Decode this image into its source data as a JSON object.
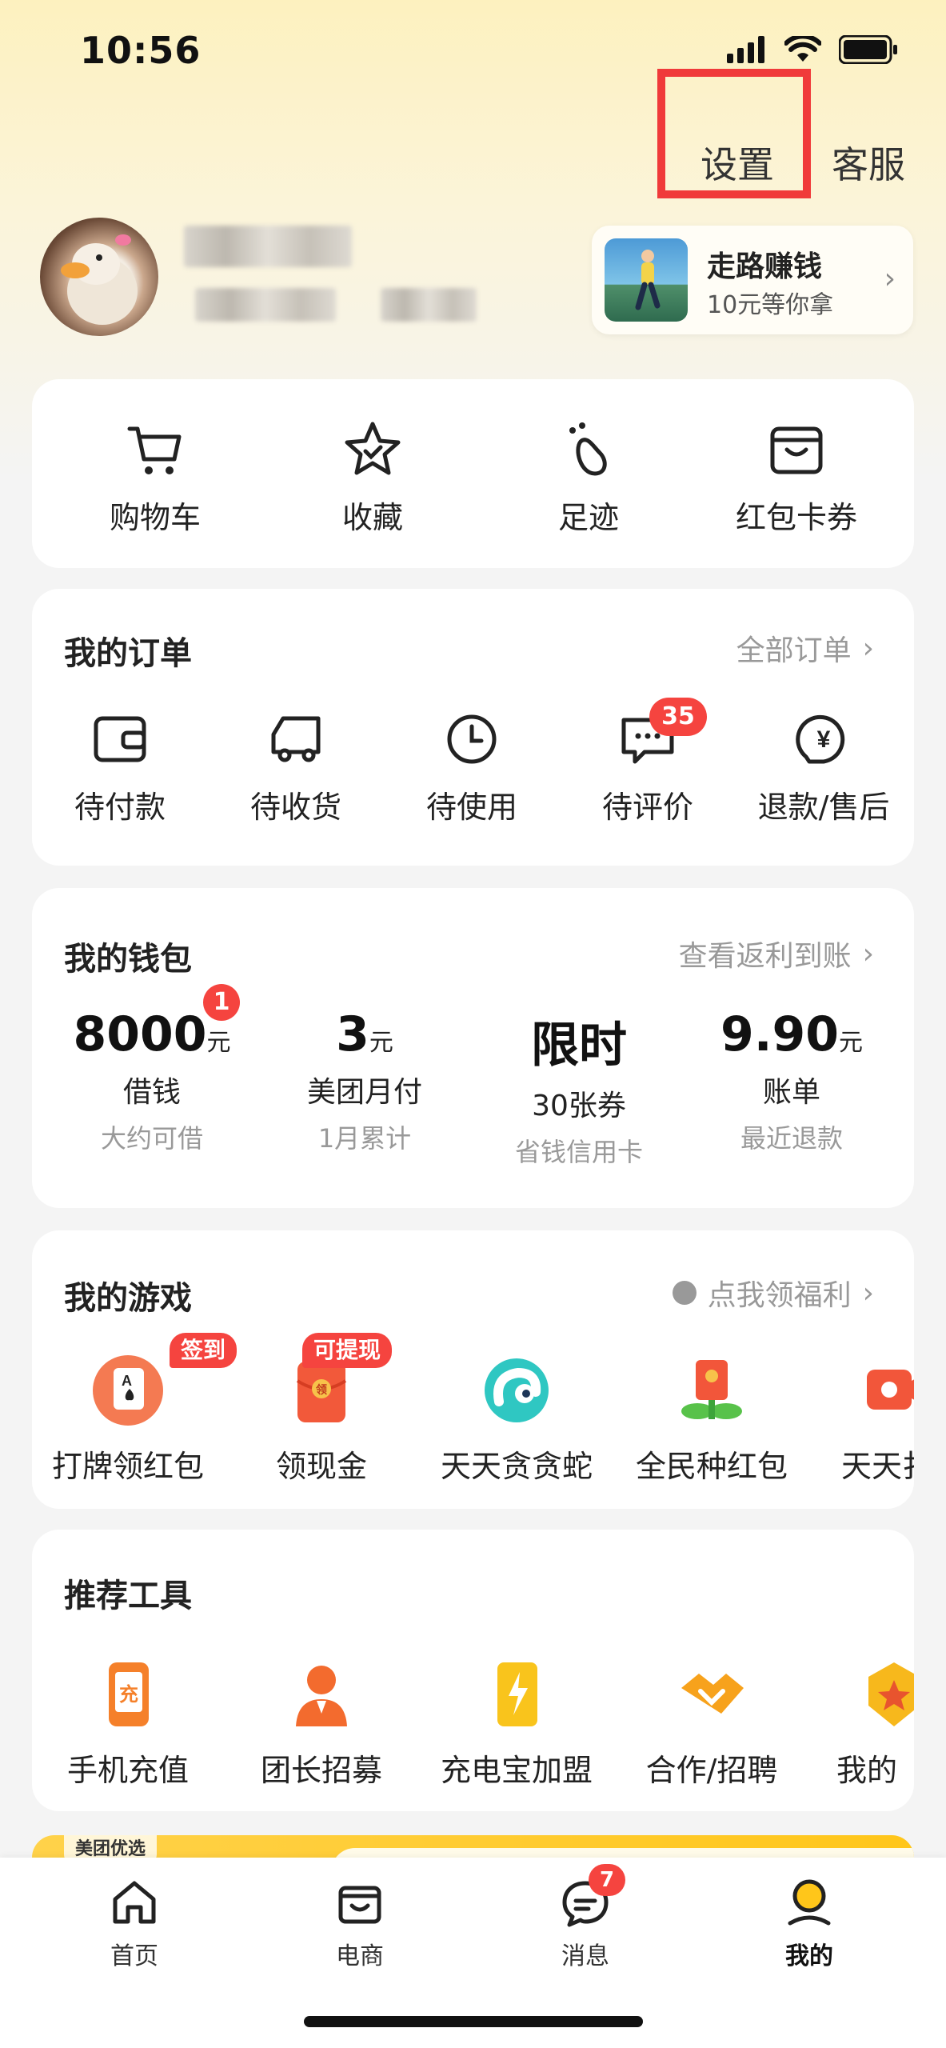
{
  "status_bar": {
    "time": "10:56"
  },
  "header": {
    "settings": "设置",
    "service": "客服"
  },
  "walk_card": {
    "title": "走路赚钱",
    "subtitle": "10元等你拿"
  },
  "quick_links": [
    {
      "label": "购物车",
      "icon": "cart-icon"
    },
    {
      "label": "收藏",
      "icon": "star-icon"
    },
    {
      "label": "足迹",
      "icon": "footprint-icon"
    },
    {
      "label": "红包卡券",
      "icon": "coupon-wallet-icon"
    }
  ],
  "orders": {
    "title": "我的订单",
    "link": "全部订单",
    "items": [
      {
        "label": "待付款",
        "icon": "wallet-icon"
      },
      {
        "label": "待收货",
        "icon": "truck-icon"
      },
      {
        "label": "待使用",
        "icon": "clock-icon"
      },
      {
        "label": "待评价",
        "icon": "comment-icon",
        "badge": "35"
      },
      {
        "label": "退款/售后",
        "icon": "refund-icon"
      }
    ]
  },
  "wallet": {
    "title": "我的钱包",
    "link": "查看返利到账",
    "items": [
      {
        "value": "8000",
        "unit": "元",
        "label": "借钱",
        "sub": "大约可借",
        "badge": "1"
      },
      {
        "value": "3",
        "unit": "元",
        "label": "美团月付",
        "sub": "1月累计"
      },
      {
        "value": "限时",
        "unit": "",
        "label": "30张券",
        "sub": "省钱信用卡"
      },
      {
        "value": "9.90",
        "unit": "元",
        "label": "账单",
        "sub": "最近退款"
      }
    ]
  },
  "games": {
    "title": "我的游戏",
    "link": "点我领福利",
    "items": [
      {
        "label": "打牌领红包",
        "tag": "签到",
        "icon": "card-game-icon"
      },
      {
        "label": "领现金",
        "tag": "可提现",
        "icon": "red-envelope-icon",
        "glyph": "领"
      },
      {
        "label": "天天贪贪蛇",
        "icon": "snake-icon"
      },
      {
        "label": "全民种红包",
        "icon": "plant-envelope-icon"
      },
      {
        "label": "天天扌",
        "icon": "video-envelope-icon"
      }
    ]
  },
  "tools": {
    "title": "推荐工具",
    "items": [
      {
        "label": "手机充值",
        "icon": "phone-recharge-icon",
        "glyph": "充"
      },
      {
        "label": "团长招募",
        "icon": "leader-icon"
      },
      {
        "label": "充电宝加盟",
        "icon": "powerbank-icon"
      },
      {
        "label": "合作/招聘",
        "icon": "handshake-icon"
      },
      {
        "label": "我的",
        "icon": "badge-icon"
      }
    ]
  },
  "banner": {
    "label": "美团优选"
  },
  "tabbar": [
    {
      "label": "首页",
      "icon": "home-icon"
    },
    {
      "label": "电商",
      "icon": "shop-icon"
    },
    {
      "label": "消息",
      "icon": "message-icon",
      "badge": "7"
    },
    {
      "label": "我的",
      "icon": "profile-icon",
      "active": true
    }
  ],
  "colors": {
    "accent": "#ffc61a",
    "badge": "#f5443f",
    "highlight_box": "#f03a3a"
  }
}
